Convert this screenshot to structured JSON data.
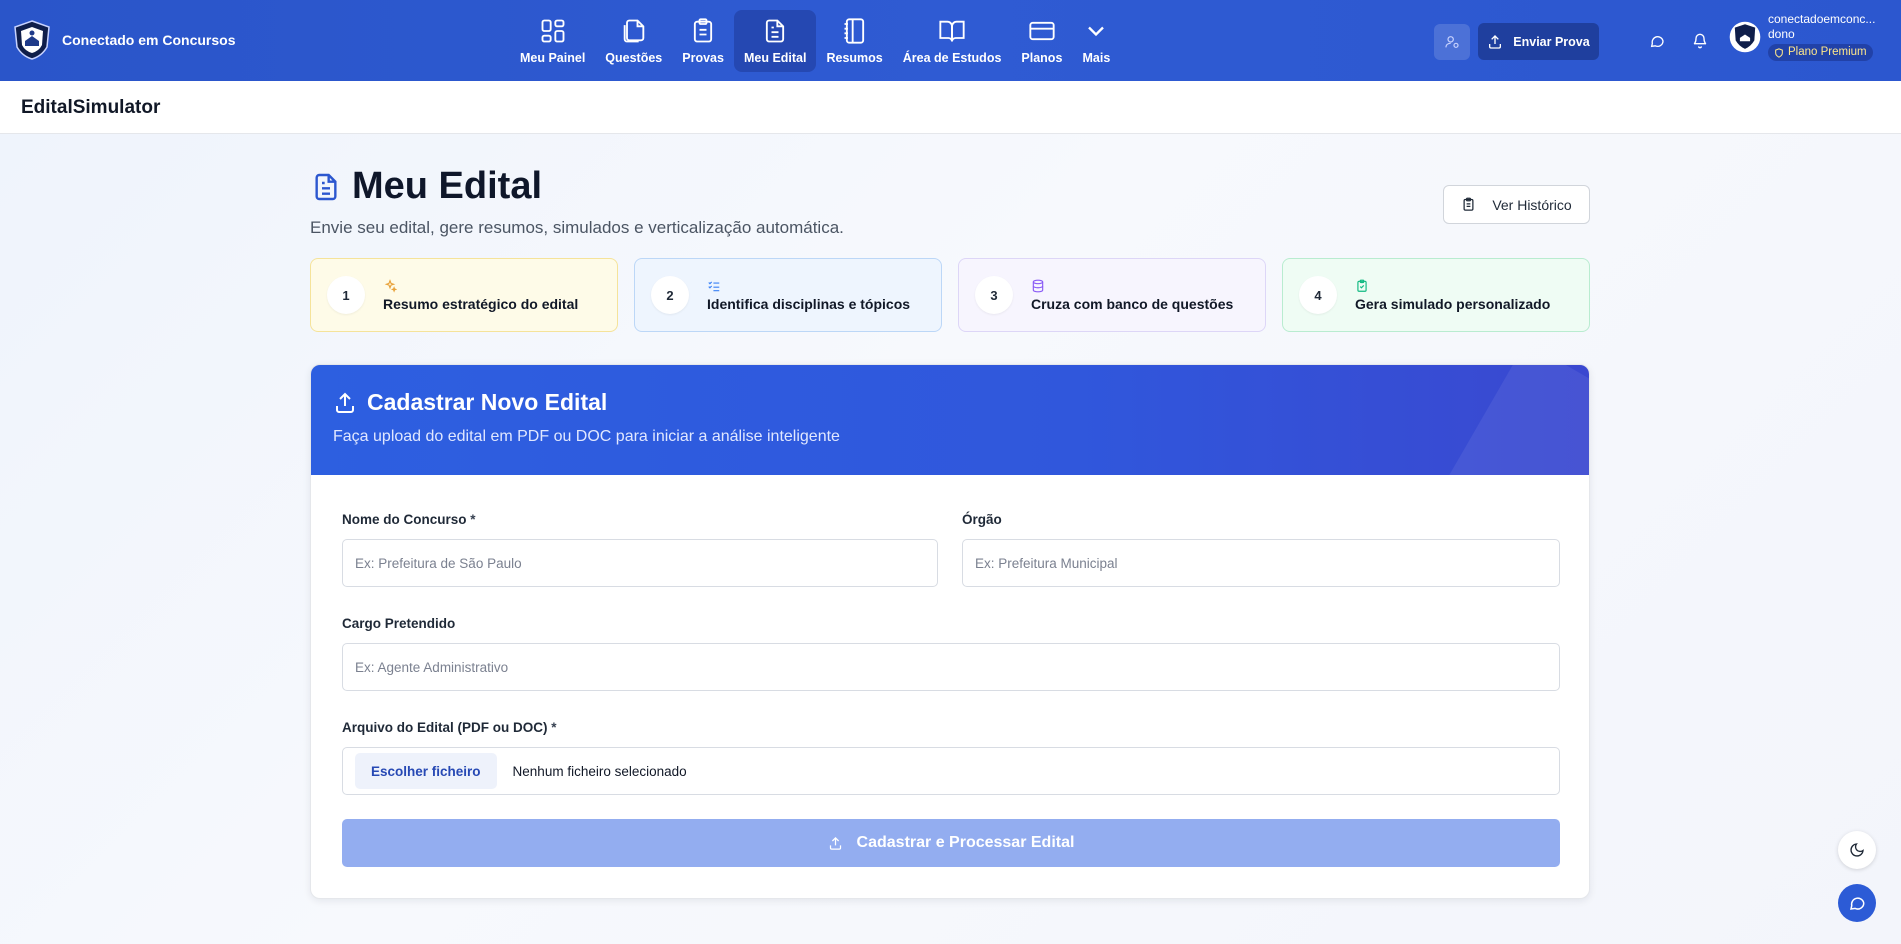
{
  "brand": {
    "name": "Conectado em Concursos"
  },
  "nav": [
    {
      "label": "Meu Painel",
      "icon": "dashboard-icon",
      "active": false
    },
    {
      "label": "Questões",
      "icon": "copy-icon",
      "active": false
    },
    {
      "label": "Provas",
      "icon": "clipboard-icon",
      "active": false
    },
    {
      "label": "Meu Edital",
      "icon": "document-icon",
      "active": true
    },
    {
      "label": "Resumos",
      "icon": "notebook-icon",
      "active": false
    },
    {
      "label": "Área de Estudos",
      "icon": "book-open-icon",
      "active": false
    },
    {
      "label": "Planos",
      "icon": "card-icon",
      "active": false
    },
    {
      "label": "Mais",
      "icon": "chevron-down-icon",
      "active": false
    }
  ],
  "toolbar": {
    "send_label": "Enviar Prova"
  },
  "user": {
    "name": "conectadoemconc...",
    "role": "dono",
    "plan": "Plano Premium"
  },
  "subheader": {
    "title": "EditalSimulator"
  },
  "page": {
    "title": "Meu Edital",
    "subtitle": "Envie seu edital, gere resumos, simulados e verticalização automática.",
    "history_label": "Ver Histórico"
  },
  "steps": [
    {
      "num": "1",
      "label": "Resumo estratégico do edital",
      "icon": "sparkles-icon",
      "color": "#e8a23a"
    },
    {
      "num": "2",
      "label": "Identifica disciplinas e tópicos",
      "icon": "list-check-icon",
      "color": "#3b82f6"
    },
    {
      "num": "3",
      "label": "Cruza com banco de questões",
      "icon": "database-icon",
      "color": "#8b5cf6"
    },
    {
      "num": "4",
      "label": "Gera simulado personalizado",
      "icon": "clipboard-check-icon",
      "color": "#10b981"
    }
  ],
  "card": {
    "title": "Cadastrar Novo Edital",
    "subtitle": "Faça upload do edital em PDF ou DOC para iniciar a análise inteligente"
  },
  "form": {
    "concurso_label": "Nome do Concurso",
    "concurso_placeholder": "Ex: Prefeitura de São Paulo",
    "orgao_label": "Órgão",
    "orgao_placeholder": "Ex: Prefeitura Municipal",
    "cargo_label": "Cargo Pretendido",
    "cargo_placeholder": "Ex: Agente Administrativo",
    "arquivo_label": "Arquivo do Edital (PDF ou DOC)",
    "required_mark": "*",
    "file_button": "Escolher ficheiro",
    "file_status": "Nenhum ficheiro selecionado",
    "submit_label": "Cadastrar e Processar Edital"
  },
  "colors": {
    "primary": "#2c57cf",
    "submit_disabled": "#93adf0"
  }
}
